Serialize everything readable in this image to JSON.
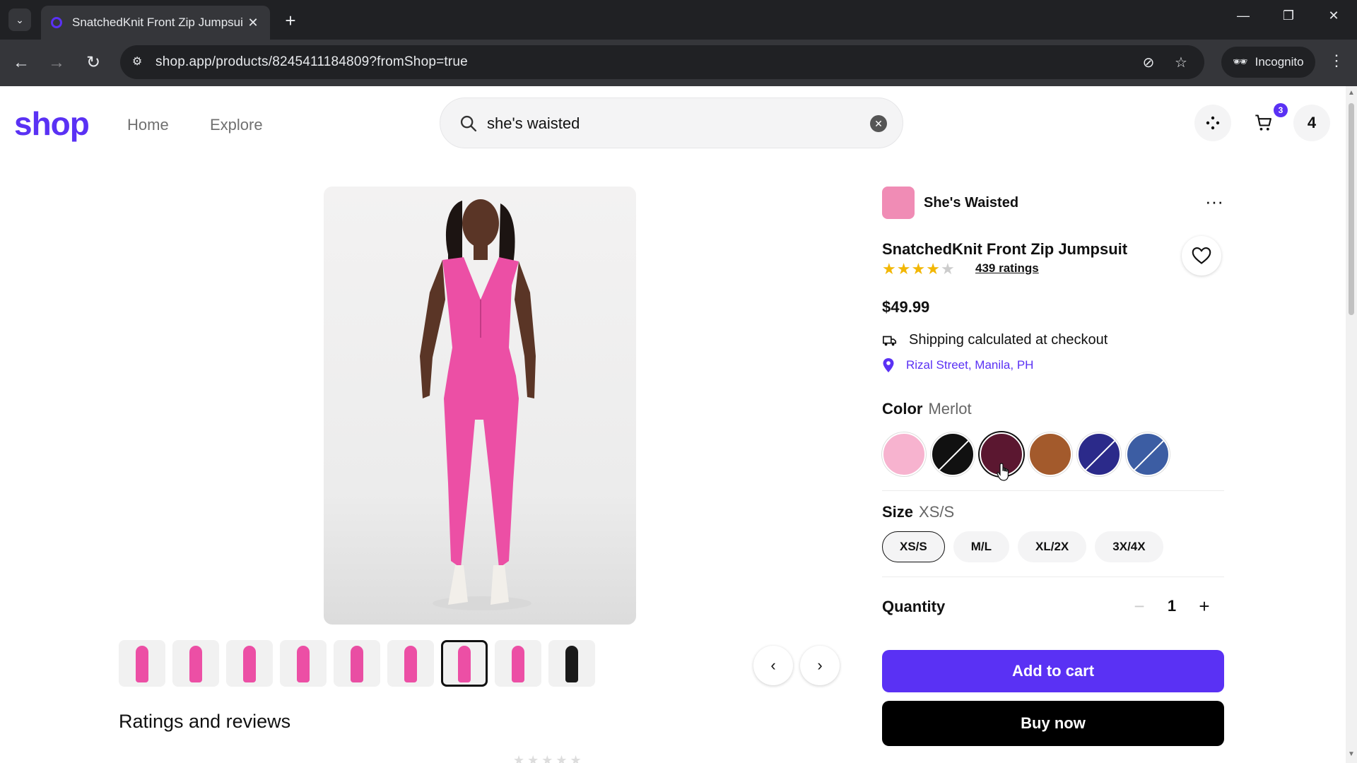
{
  "browser": {
    "tab_title": "SnatchedKnit Front Zip Jumpsui",
    "url": "shop.app/products/8245411184809?fromShop=true",
    "incognito_label": "Incognito"
  },
  "header": {
    "logo": "shop",
    "nav": [
      "Home",
      "Explore"
    ],
    "search_value": "she's waisted",
    "cart_badge": "3",
    "account_label": "4"
  },
  "gallery": {
    "thumbnail_colors": [
      "#ec4fa5",
      "#ec4fa5",
      "#ec4fa5",
      "#ec4fa5",
      "#e94ea3",
      "#ec4fa5",
      "#ec4fa5",
      "#ec4fa5",
      "#1a1a1a"
    ],
    "selected_thumbnail": 6,
    "reviews_title": "Ratings and reviews"
  },
  "product": {
    "shop_name": "She's Waisted",
    "title": "SnatchedKnit Front Zip Jumpsuit",
    "rating": 4,
    "ratings_link": "439 ratings",
    "price": "$49.99",
    "shipping": "Shipping calculated at checkout",
    "location": "Rizal Street, Manila, PH",
    "color_label": "Color",
    "color_value": "Merlot",
    "colors": [
      {
        "name": "Pink",
        "hex": "#f7b3cf",
        "sold_out": false
      },
      {
        "name": "Black",
        "hex": "#111111",
        "sold_out": true
      },
      {
        "name": "Merlot",
        "hex": "#5b1730",
        "sold_out": false,
        "selected": true
      },
      {
        "name": "Brown",
        "hex": "#a35a2c",
        "sold_out": false
      },
      {
        "name": "Navy",
        "hex": "#2b2a8a",
        "sold_out": true
      },
      {
        "name": "Blue",
        "hex": "#3c5da3",
        "sold_out": true
      }
    ],
    "size_label": "Size",
    "size_value": "XS/S",
    "sizes": [
      "XS/S",
      "M/L",
      "XL/2X",
      "3X/4X"
    ],
    "selected_size": 0,
    "quantity_label": "Quantity",
    "quantity": "1",
    "add_to_cart": "Add to cart",
    "buy_now": "Buy now"
  },
  "colors": {
    "accent": "#5a31f4",
    "star": "#f2b705"
  }
}
